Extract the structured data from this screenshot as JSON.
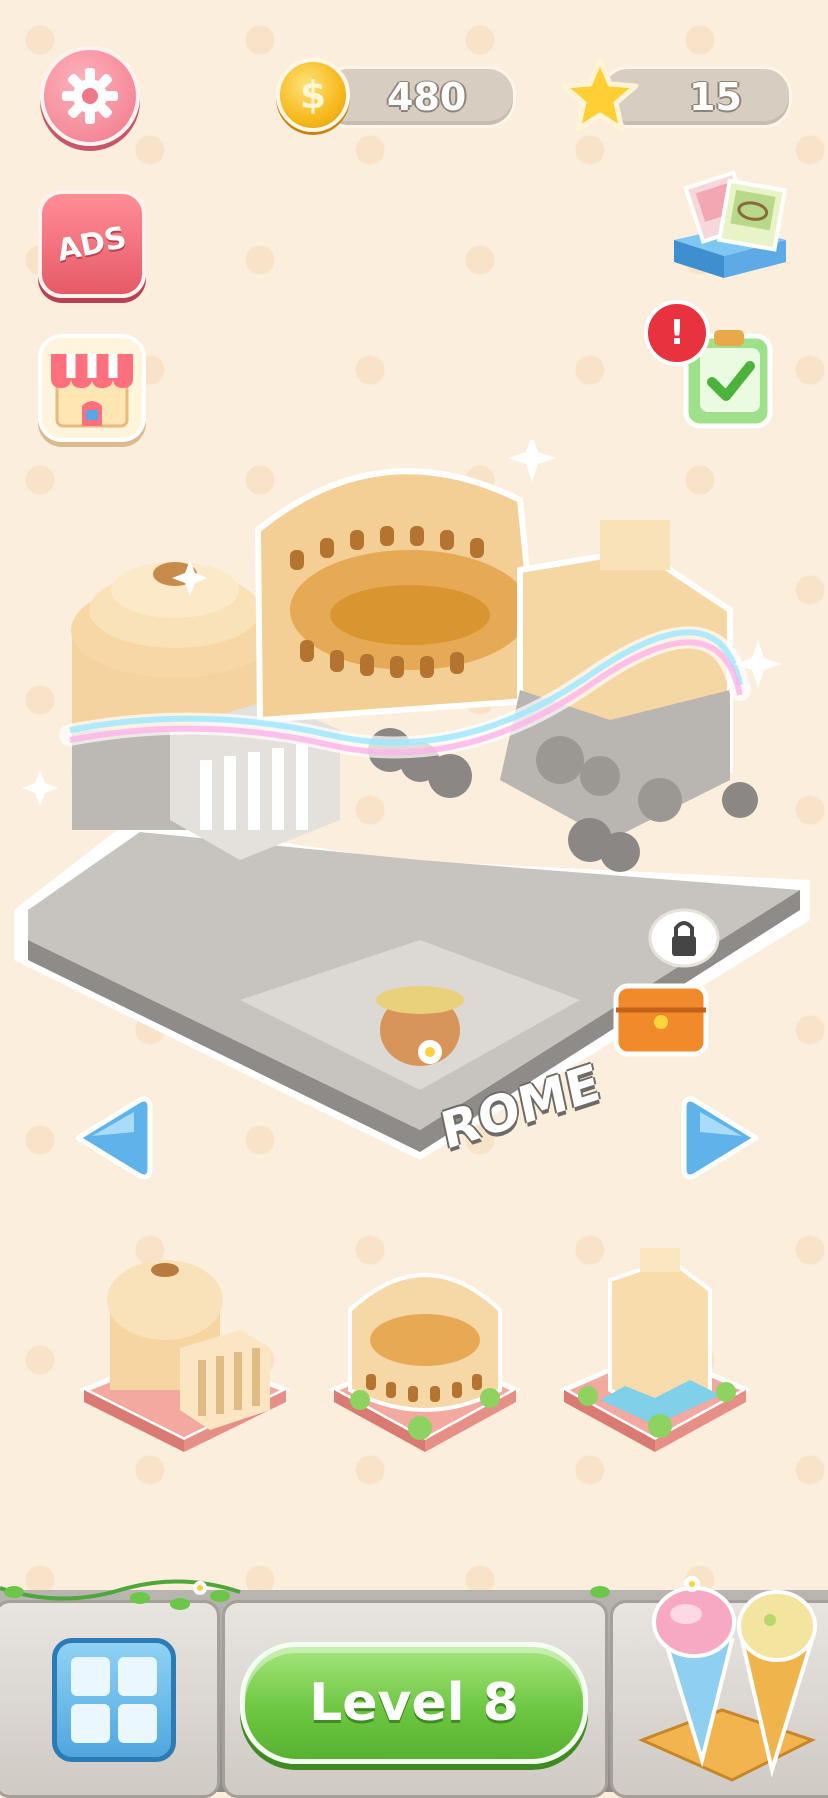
{
  "hud": {
    "coins": "480",
    "coin_symbol": "$",
    "stars": "15"
  },
  "left_buttons": {
    "ads_label": "ADS"
  },
  "notification": {
    "badge": "!"
  },
  "city": {
    "name": "ROME"
  },
  "landmarks": [
    {
      "icon": "pantheon-icon"
    },
    {
      "icon": "colosseum-icon"
    },
    {
      "icon": "trevi-fountain-icon"
    }
  ],
  "bottom": {
    "level_label": "Level 8"
  },
  "colors": {
    "background": "#fbeedd",
    "level_green": "#6ec742",
    "arrow_blue": "#5fb3ea"
  }
}
